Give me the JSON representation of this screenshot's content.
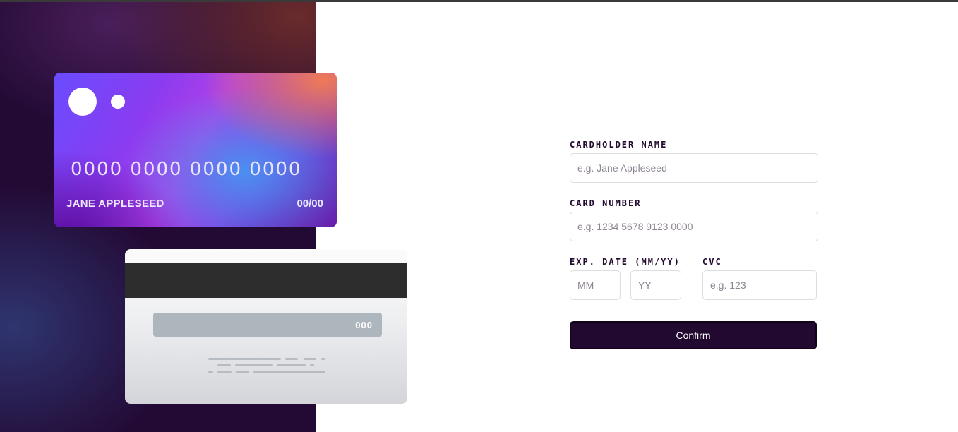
{
  "card_front": {
    "number": "0000 0000 0000 0000",
    "name": "JANE APPLESEED",
    "expiry": "00/00"
  },
  "card_back": {
    "cvc": "000"
  },
  "form": {
    "cardholder_label": "CARDHOLDER NAME",
    "cardholder_placeholder": "e.g. Jane Appleseed",
    "number_label": "CARD NUMBER",
    "number_placeholder": "e.g. 1234 5678 9123 0000",
    "expiry_label": "EXP. DATE (MM/YY)",
    "month_placeholder": "MM",
    "year_placeholder": "YY",
    "cvc_label": "CVC",
    "cvc_placeholder": "e.g. 123",
    "confirm_label": "Confirm"
  },
  "colors": {
    "dark_violet": "#21092f",
    "input_border": "#dedddf",
    "placeholder": "#8e8593"
  }
}
